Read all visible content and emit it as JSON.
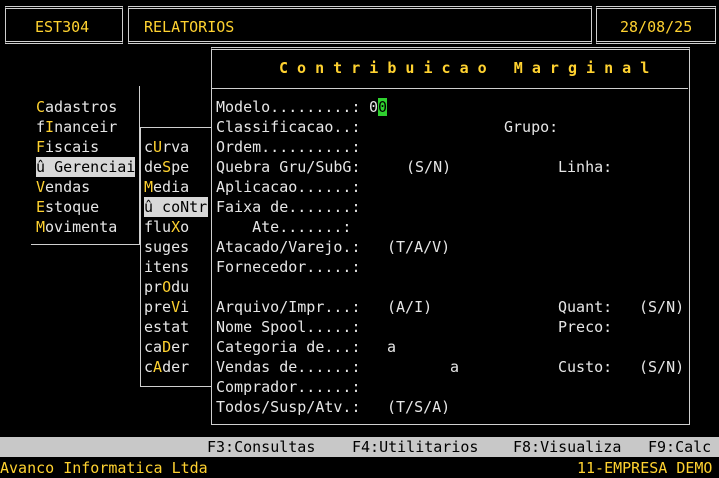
{
  "header": {
    "module": "EST304",
    "section": "RELATORIOS",
    "date": "28/08/25"
  },
  "main_menu": [
    {
      "pre": "",
      "key": "C",
      "post": "adastros"
    },
    {
      "pre": "f",
      "key": "I",
      "post": "nanceir"
    },
    {
      "pre": "",
      "key": "F",
      "post": "iscais"
    },
    {
      "pre": "û ",
      "key": "G",
      "post": "erenciai"
    },
    {
      "pre": "",
      "key": "V",
      "post": "endas"
    },
    {
      "pre": "",
      "key": "E",
      "post": "stoque"
    },
    {
      "pre": "",
      "key": "M",
      "post": "ovimenta"
    }
  ],
  "sub_menu": [
    {
      "pre": "c",
      "key": "U",
      "post": "rva"
    },
    {
      "pre": "de",
      "key": "S",
      "post": "pe"
    },
    {
      "pre": "",
      "key": "M",
      "post": "edia"
    },
    {
      "pre": "û co",
      "key": "N",
      "post": "tr"
    },
    {
      "pre": "flu",
      "key": "X",
      "post": "o"
    },
    {
      "pre": "suges",
      "key": "",
      "post": ""
    },
    {
      "pre": "itens",
      "key": "",
      "post": ""
    },
    {
      "pre": "pr",
      "key": "O",
      "post": "du"
    },
    {
      "pre": "pre",
      "key": "V",
      "post": "i"
    },
    {
      "pre": "estat",
      "key": "",
      "post": ""
    },
    {
      "pre": "ca",
      "key": "D",
      "post": "er"
    },
    {
      "pre": "c",
      "key": "A",
      "post": "der"
    }
  ],
  "dialog": {
    "title": "C o n t r i b u i c a o   M a r g i n a l",
    "modelo_label": "Modelo.........:",
    "modelo_value_a": "0",
    "modelo_value_b": "0",
    "classificacao_label": "Classificacao..:",
    "grupo_label": "Grupo:",
    "ordem_label": "Ordem..........:",
    "quebra_label": "Quebra Gru/SubG:",
    "quebra_hint": "(S/N)",
    "linha_label": "Linha:",
    "aplicacao_label": "Aplicacao......:",
    "faixa_label": "Faixa de.......:",
    "ate_label": "    Ate.......:",
    "atacado_label": "Atacado/Varejo.:",
    "atacado_hint": "(T/A/V)",
    "fornecedor_label": "Fornecedor.....:",
    "arquivo_label": "Arquivo/Impr...:",
    "arquivo_hint": "(A/I)",
    "quant_label": "Quant:",
    "quant_hint": "(S/N)",
    "spool_label": "Nome Spool.....:",
    "preco_label": "Preco:",
    "categoria_label": "Categoria de...:",
    "categoria_sep": "a",
    "vendas_label": "Vendas de......:",
    "vendas_sep": "a",
    "custo_label": "Custo:",
    "custo_hint": "(S/N)",
    "comprador_label": "Comprador......:",
    "todos_label": "Todos/Susp/Atv.:",
    "todos_hint": "(T/S/A)"
  },
  "function_keys": [
    "F3:Consultas",
    "F4:Utilitarios",
    "F8:Visualiza",
    "F9:Calc"
  ],
  "status": {
    "company": "Avanco Informatica Ltda",
    "empresa": "11-EMPRESA DEMO"
  }
}
